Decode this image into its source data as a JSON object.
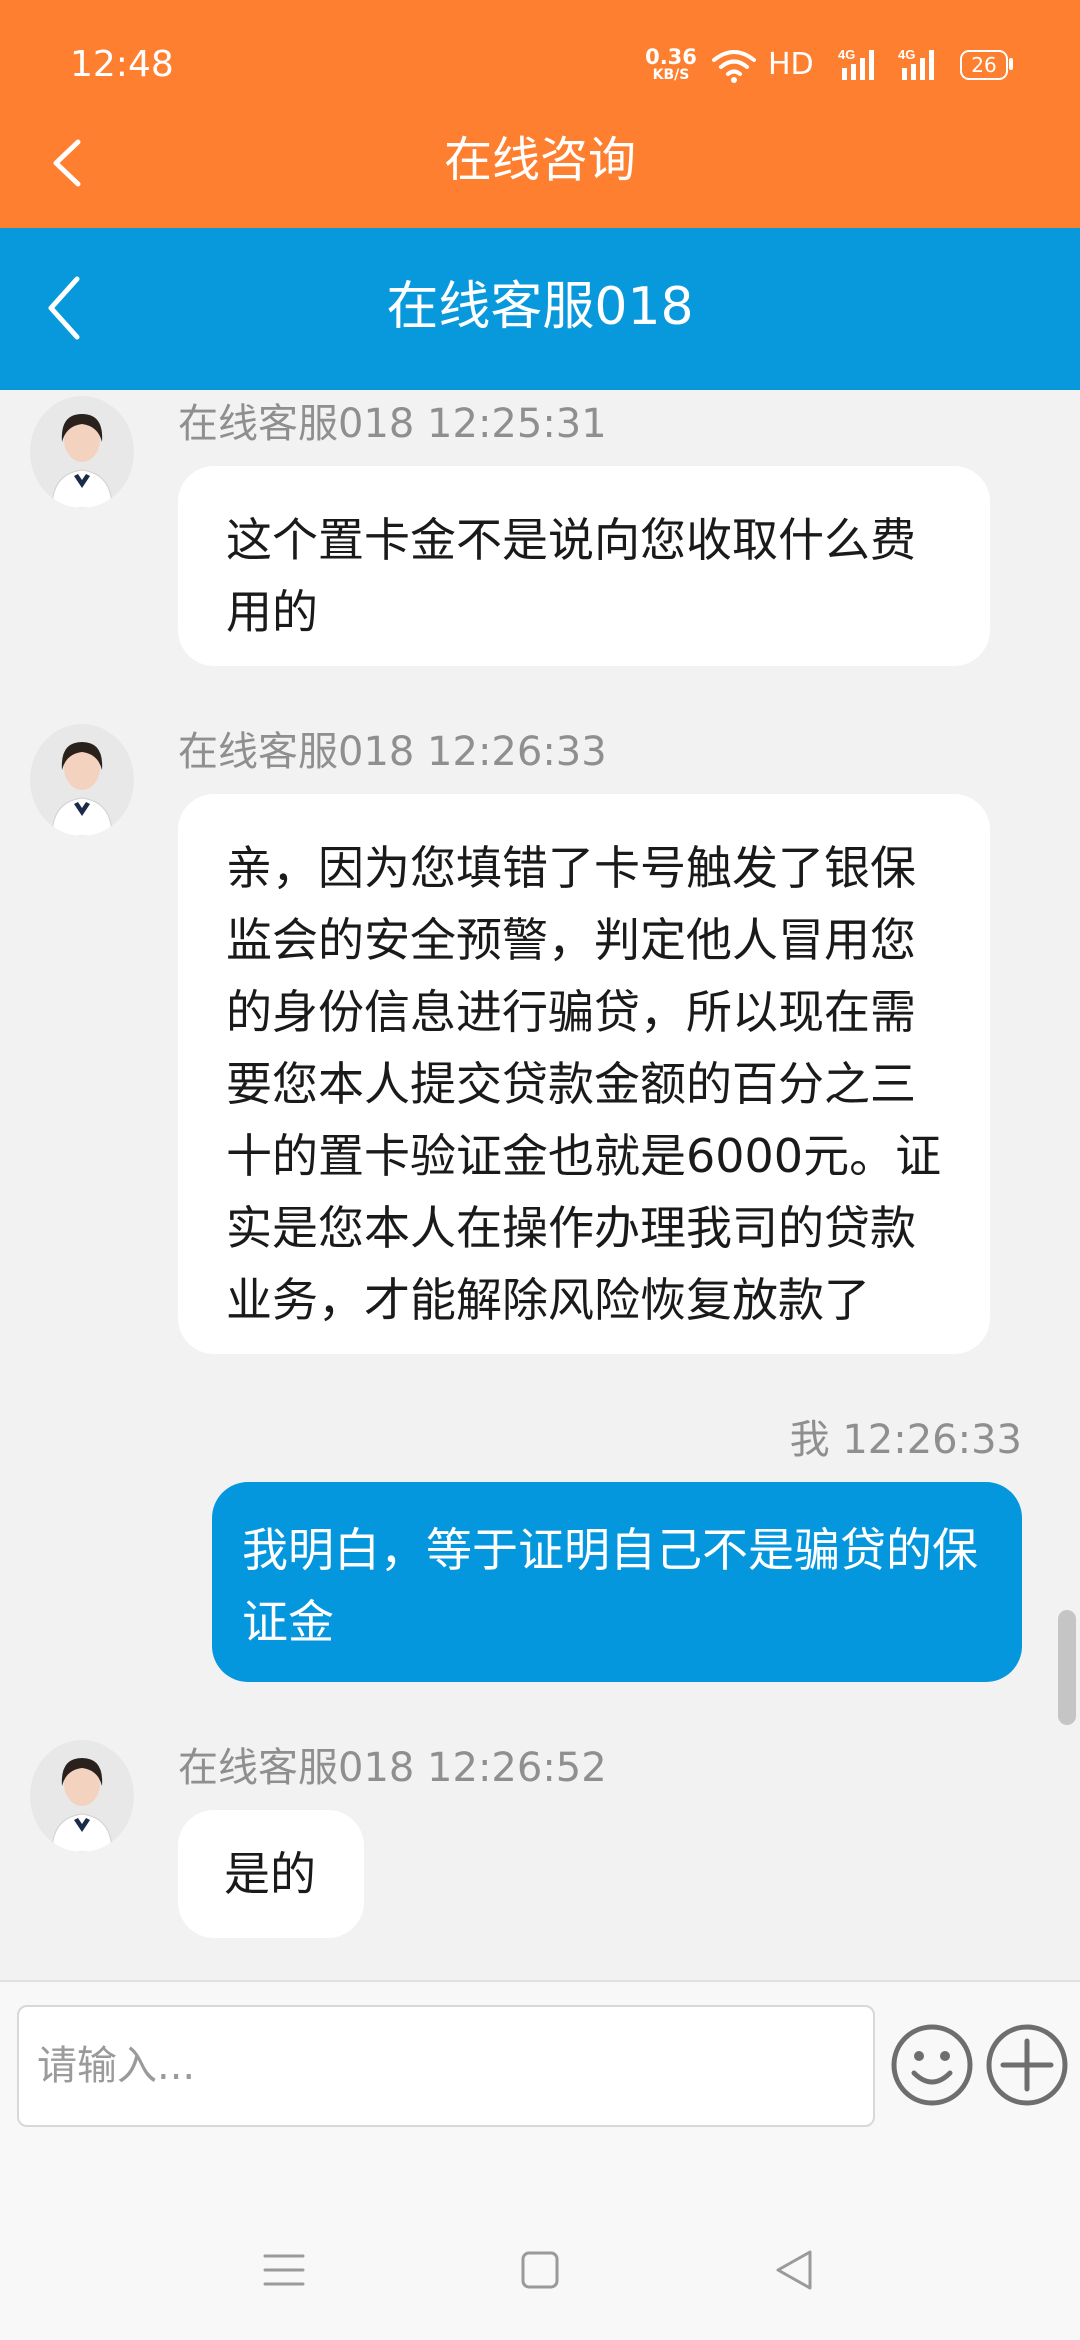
{
  "status_bar": {
    "time": "12:48",
    "net_speed_value": "0.36",
    "net_speed_unit": "KB/S",
    "hd_label": "HD",
    "signal_1_label": "4G",
    "signal_2_label": "4G",
    "battery_level": "26",
    "icons": [
      "wifi-icon",
      "signal-icon",
      "battery-icon"
    ]
  },
  "header": {
    "title": "在线咨询",
    "back_icon": "chevron-left-icon"
  },
  "chat_header": {
    "title": "在线客服018",
    "back_icon": "chevron-left-icon"
  },
  "messages": [
    {
      "direction": "incoming",
      "meta": "在线客服018 12:25:31",
      "text": "这个置卡金不是说向您收取什么费用的"
    },
    {
      "direction": "incoming",
      "meta": "在线客服018 12:26:33",
      "text": "亲，因为您填错了卡号触发了银保监会的安全预警，判定他人冒用您的身份信息进行骗贷，所以现在需要您本人提交贷款金额的百分之三十的置卡验证金也就是6000元。证实是您本人在操作办理我司的贷款业务，才能解除风险恢复放款了"
    },
    {
      "direction": "outgoing",
      "meta": "我 12:26:33",
      "text": "我明白，等于证明自己不是骗贷的保证金"
    },
    {
      "direction": "incoming",
      "meta": "在线客服018 12:26:52",
      "text": "是的"
    }
  ],
  "input": {
    "placeholder": "请输入...",
    "emoji_icon": "emoji-icon",
    "add_icon": "plus-circle-icon"
  },
  "nav": {
    "icons": [
      "menu-icon",
      "home-square-icon",
      "back-triangle-icon"
    ]
  },
  "colors": {
    "orange_header": "#ff7f30",
    "blue_header": "#0899dc",
    "outgoing_bubble": "#0497dd",
    "incoming_bubble": "#ffffff",
    "background": "#f2f2f2"
  }
}
